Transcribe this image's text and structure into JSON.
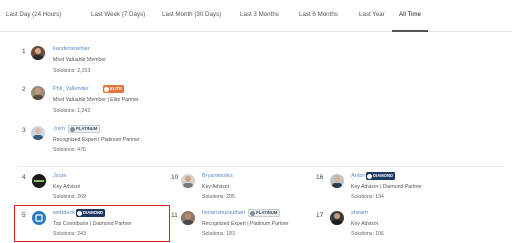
{
  "tabs": [
    {
      "label": "Last Day (24 Hours)"
    },
    {
      "label": "Last Week (7 Days)"
    },
    {
      "label": "Last Month (30 Days)"
    },
    {
      "label": "Last 3 Months"
    },
    {
      "label": "Last 6 Months"
    },
    {
      "label": "Last Year"
    },
    {
      "label": "All Time",
      "active": true
    }
  ],
  "top": [
    {
      "rank": "1",
      "name": "karstenkoehler",
      "role": "Most Valuable Member",
      "solutions": "Solutions: 2,153"
    },
    {
      "rank": "2",
      "name": "Phil_Vallender",
      "badge": "ELITE",
      "role": "Most Valuable Member | Elite Partner",
      "solutions": "Solutions: 1,242"
    },
    {
      "rank": "3",
      "name": "Josh",
      "badge": "PLATINUM",
      "role": "Recognized Expert | Platinum Partner",
      "solutions": "Solutions: 475"
    }
  ],
  "grid": [
    {
      "rank": "4",
      "name": "Jsum",
      "role": "Key Advisor",
      "solutions": "Solutions: 269"
    },
    {
      "rank": "10",
      "name": "Bryantworks",
      "role": "Key Advisor",
      "solutions": "Solutions: 205"
    },
    {
      "rank": "16",
      "name": "Anton",
      "badge": "DIAMOND",
      "role": "Key Advisor | Diamond Partner",
      "solutions": "Solutions: 134"
    },
    {
      "rank": "5",
      "name": "webdeck",
      "badge": "DIAMOND",
      "role": "Top Contributor | Diamond Partner",
      "solutions": "Solutions: 243"
    },
    {
      "rank": "11",
      "name": "himanshurauthan",
      "badge": "PLATINUM",
      "role": "Recognized Expert | Platinum Partner",
      "solutions": "Solutions: 183"
    },
    {
      "rank": "17",
      "name": "sheam",
      "role": "Key Advisor",
      "solutions": "Solutions: 106"
    }
  ],
  "colors": {
    "accent_highlight": "#e02424",
    "elite": "#e8743b",
    "diamond": "#1e3a64",
    "link": "#5a8bc4"
  },
  "icons": {
    "elite": "star-icon",
    "platinum": "platinum-medal-icon",
    "diamond": "diamond-icon"
  }
}
